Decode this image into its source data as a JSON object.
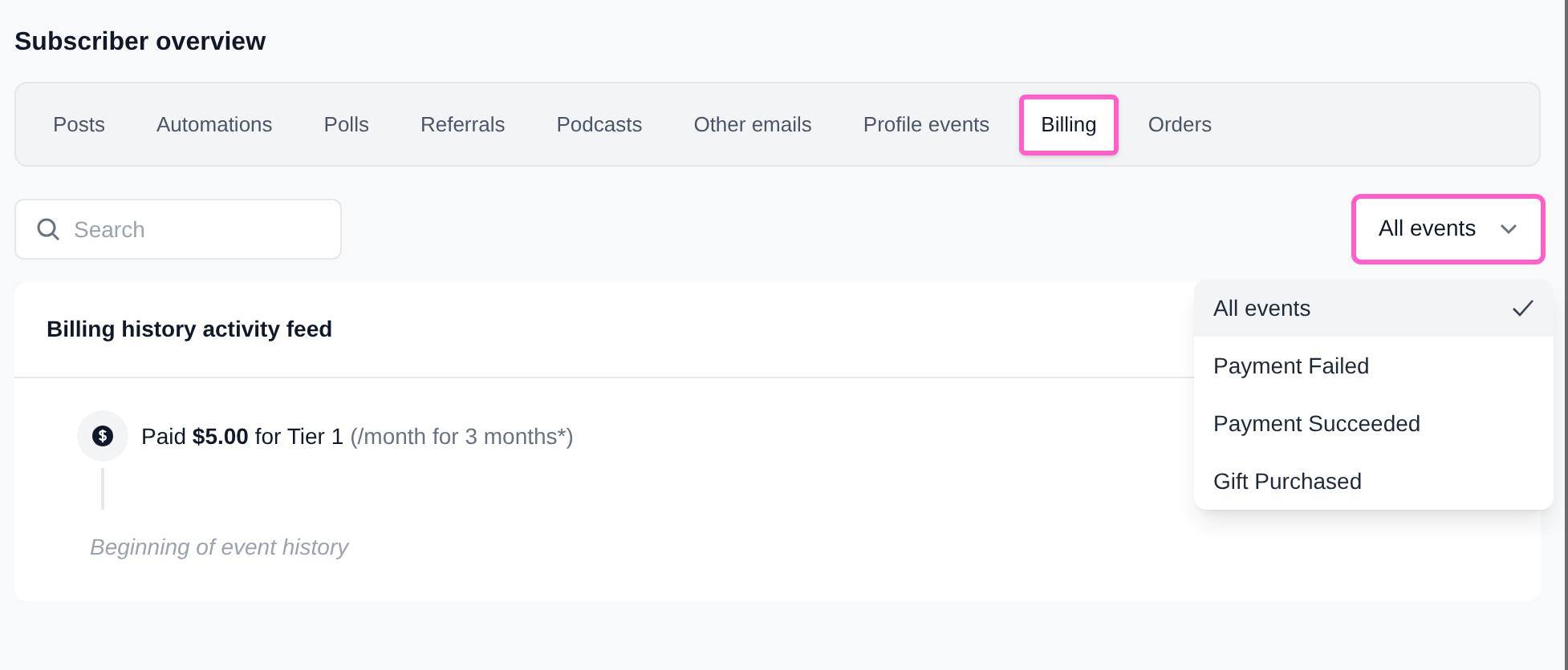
{
  "title": "Subscriber overview",
  "tabs": [
    {
      "label": "Posts",
      "selected": false,
      "highlighted": false
    },
    {
      "label": "Automations",
      "selected": false,
      "highlighted": false
    },
    {
      "label": "Polls",
      "selected": false,
      "highlighted": false
    },
    {
      "label": "Referrals",
      "selected": false,
      "highlighted": false
    },
    {
      "label": "Podcasts",
      "selected": false,
      "highlighted": false
    },
    {
      "label": "Other emails",
      "selected": false,
      "highlighted": false
    },
    {
      "label": "Profile events",
      "selected": false,
      "highlighted": false
    },
    {
      "label": "Billing",
      "selected": true,
      "highlighted": true
    },
    {
      "label": "Orders",
      "selected": false,
      "highlighted": false
    }
  ],
  "search": {
    "placeholder": "Search"
  },
  "filter": {
    "value": "All events",
    "highlighted": true,
    "expanded": true,
    "options": [
      {
        "label": "All events",
        "selected": true
      },
      {
        "label": "Payment Failed",
        "selected": false
      },
      {
        "label": "Payment Succeeded",
        "selected": false
      },
      {
        "label": "Gift Purchased",
        "selected": false
      }
    ]
  },
  "feed": {
    "title": "Billing history activity feed",
    "events": [
      {
        "text": "Paid **$5.00** for Tier 1",
        "note": "(/month for 3 months*)"
      }
    ],
    "end_label": "Beginning of event history"
  }
}
